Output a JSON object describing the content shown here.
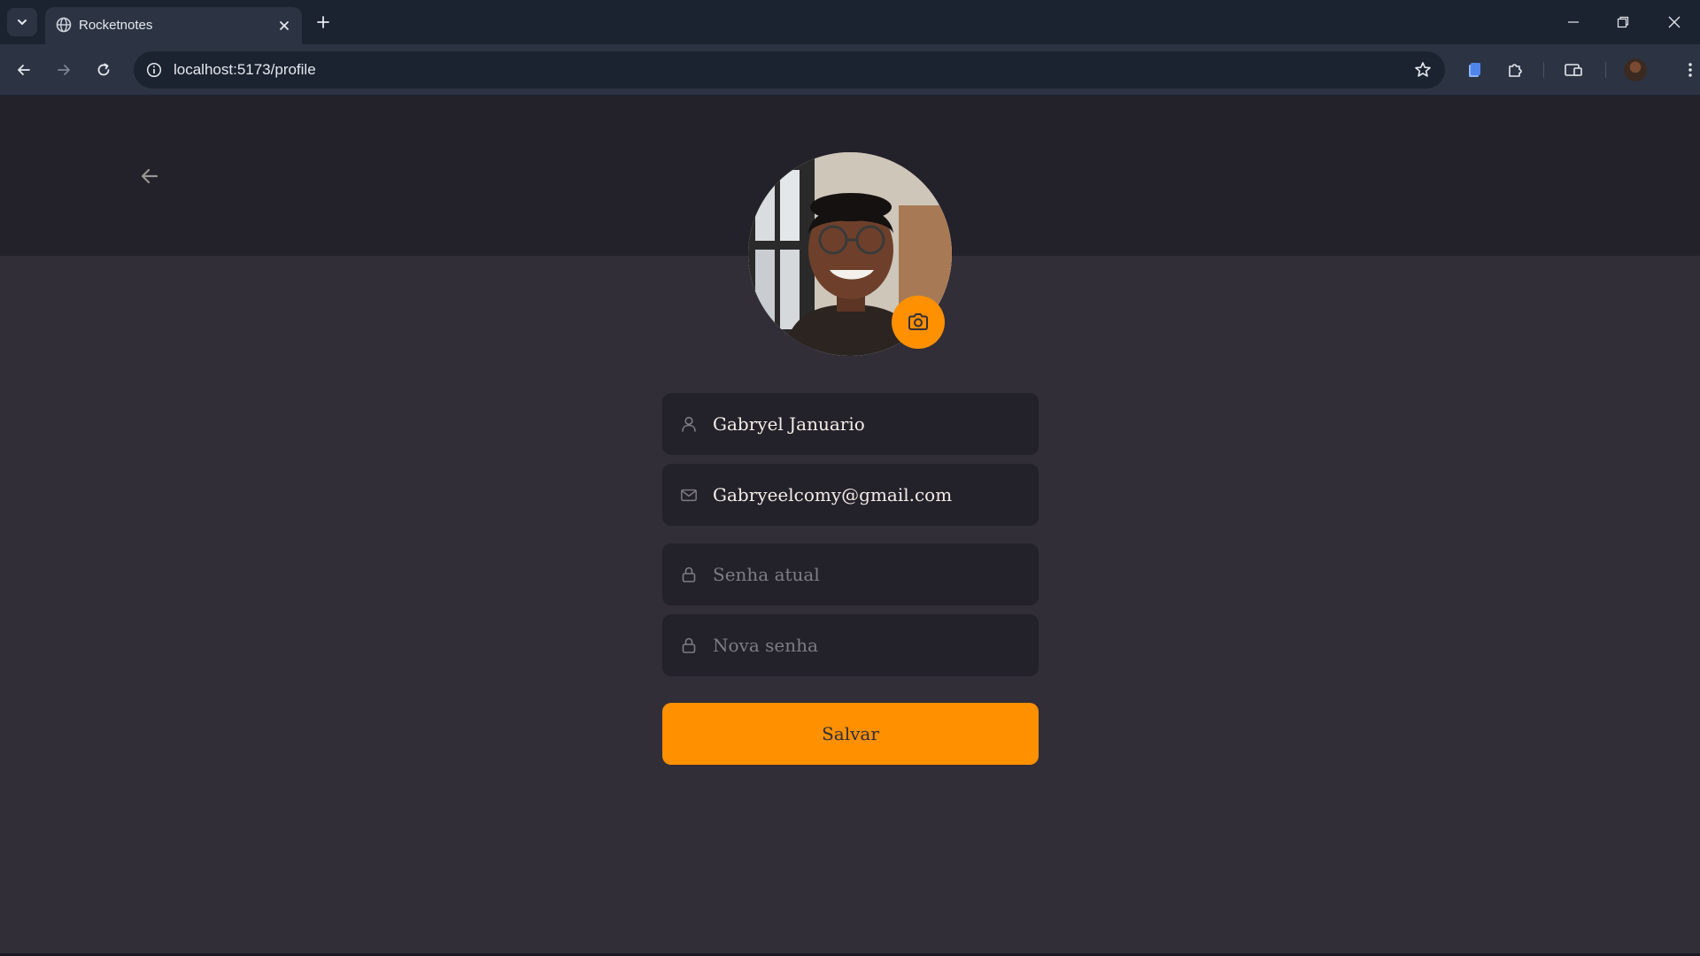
{
  "browser": {
    "tab_title": "Rocketnotes",
    "url": "localhost:5173/profile"
  },
  "profile": {
    "name": "Gabryel Januario",
    "email": "Gabryeelcomy@gmail.com",
    "current_password_placeholder": "Senha atual",
    "new_password_placeholder": "Nova senha",
    "save_label": "Salvar"
  },
  "colors": {
    "accent": "#ff9000",
    "background": "#312e38",
    "header_background": "#232129",
    "input_background": "#232129",
    "text": "#f4ede8",
    "placeholder": "#7f7c85"
  },
  "icons": {
    "back": "arrow-left-icon",
    "camera": "camera-icon",
    "name_field": "user-icon",
    "email_field": "mail-icon",
    "password_field": "lock-icon"
  }
}
